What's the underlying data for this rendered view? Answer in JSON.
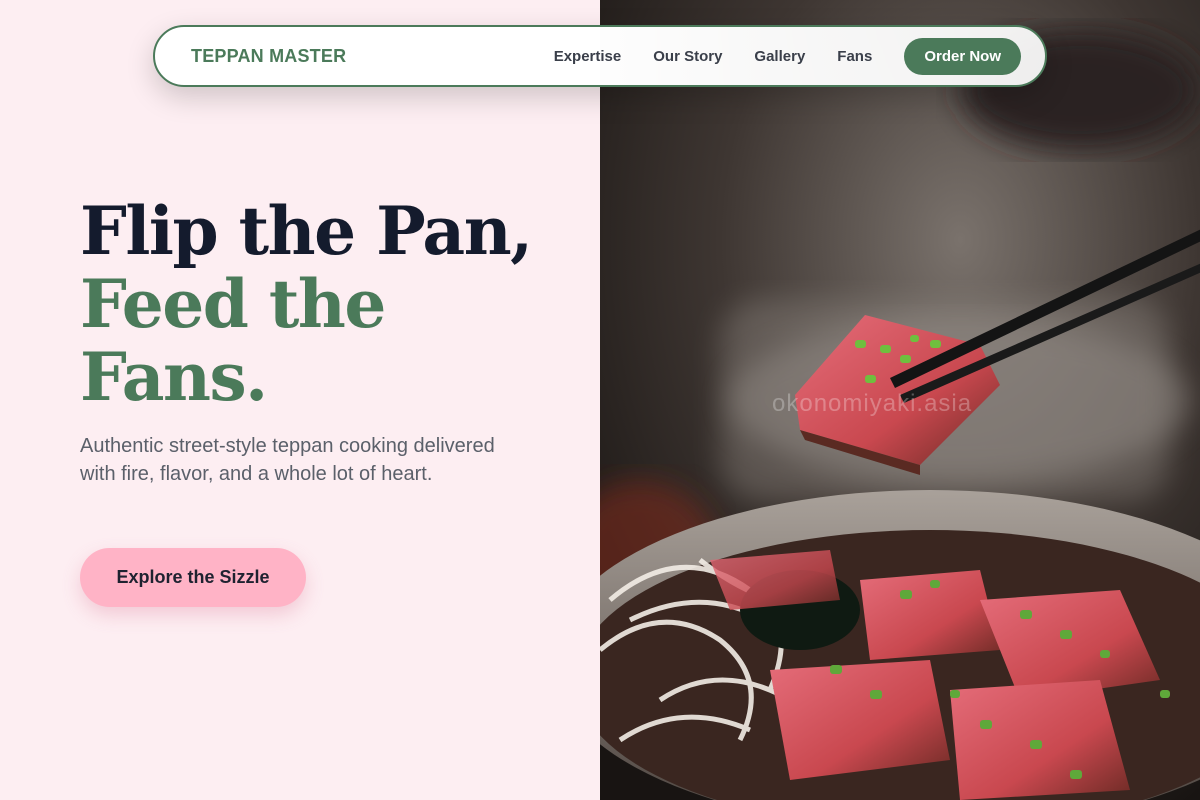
{
  "nav": {
    "brand": "TEPPAN MASTER",
    "links": [
      "Expertise",
      "Our Story",
      "Gallery",
      "Fans"
    ],
    "cta": "Order Now"
  },
  "hero": {
    "title_line1": "Flip the Pan,",
    "title_line2": "Feed the Fans.",
    "subtitle": "Authentic street-style teppan cooking delivered with fire, flavor, and a whole lot of heart.",
    "button": "Explore the Sizzle"
  },
  "image": {
    "watermark": "okonomiyaki.asia",
    "subject": "seared-beef-tataki-bowl"
  },
  "colors": {
    "accent_green": "#4b7a5a",
    "accent_pink": "#ffb3c6",
    "dark_text": "#141b2d",
    "left_bg": "#fdeef2"
  }
}
